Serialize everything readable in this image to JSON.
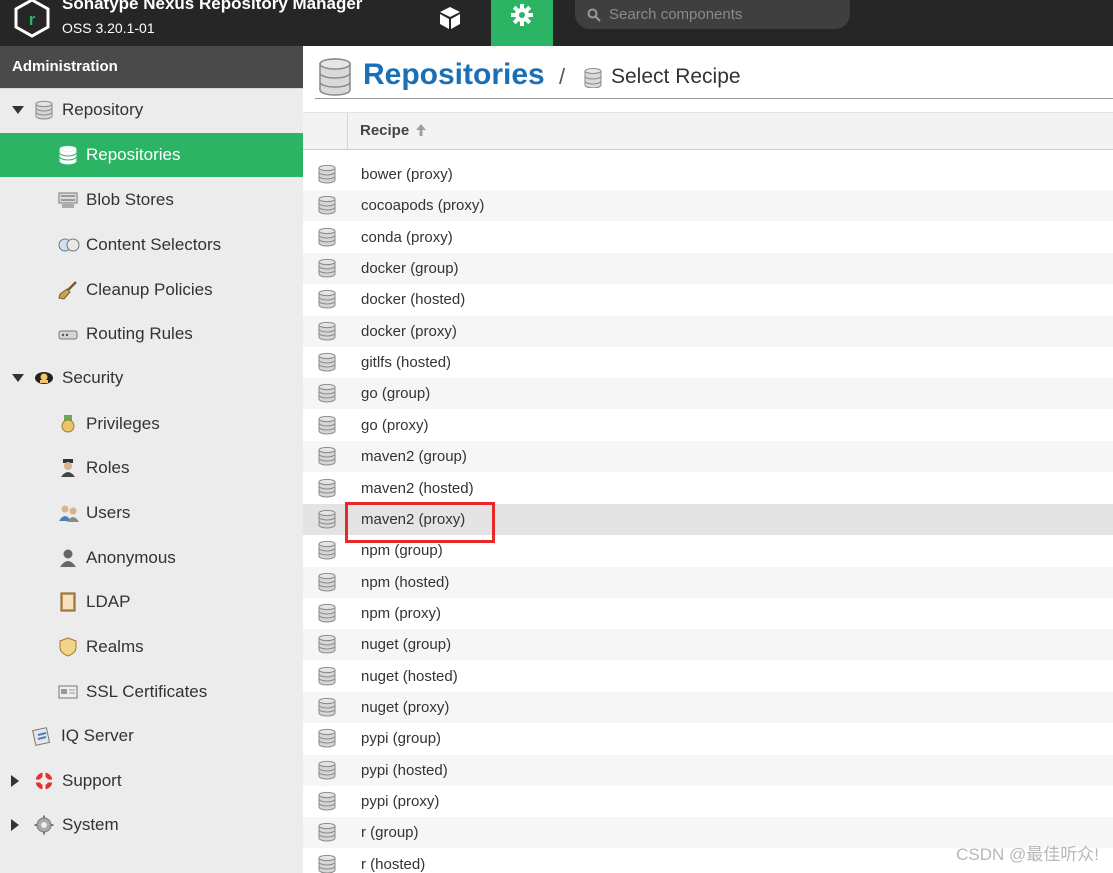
{
  "header": {
    "title": "Sonatype Nexus Repository Manager",
    "version": "OSS 3.20.1-01",
    "search_placeholder": "Search components",
    "icons": [
      "nexus-logo",
      "cube-icon",
      "gear-icon",
      "search-icon"
    ]
  },
  "sidebar": {
    "header": "Administration",
    "items": [
      {
        "label": "Repository",
        "icon": "database-icon",
        "level": 0,
        "toggle": "expanded"
      },
      {
        "label": "Repositories",
        "icon": "database-icon",
        "level": 1,
        "active": true
      },
      {
        "label": "Blob Stores",
        "icon": "server-icon",
        "level": 1
      },
      {
        "label": "Content Selectors",
        "icon": "selector-icon",
        "level": 1
      },
      {
        "label": "Cleanup Policies",
        "icon": "broom-icon",
        "level": 1
      },
      {
        "label": "Routing Rules",
        "icon": "router-icon",
        "level": 1
      },
      {
        "label": "Security",
        "icon": "badge-icon",
        "level": 0,
        "toggle": "expanded"
      },
      {
        "label": "Privileges",
        "icon": "medal-icon",
        "level": 1
      },
      {
        "label": "Roles",
        "icon": "role-icon",
        "level": 1
      },
      {
        "label": "Users",
        "icon": "users-icon",
        "level": 1
      },
      {
        "label": "Anonymous",
        "icon": "anonymous-icon",
        "level": 1
      },
      {
        "label": "LDAP",
        "icon": "book-icon",
        "level": 1
      },
      {
        "label": "Realms",
        "icon": "shield-icon",
        "level": 1
      },
      {
        "label": "SSL Certificates",
        "icon": "certificate-icon",
        "level": 1
      },
      {
        "label": "IQ Server",
        "icon": "iq-icon",
        "level": 0
      },
      {
        "label": "Support",
        "icon": "lifebuoy-icon",
        "level": 0,
        "toggle": "collapsed"
      },
      {
        "label": "System",
        "icon": "cog-icon",
        "level": 0,
        "toggle": "collapsed"
      }
    ]
  },
  "main": {
    "title": "Repositories",
    "breadcrumb_separator": "/",
    "breadcrumb": "Select Recipe",
    "column_header": "Recipe",
    "rows": [
      "bower (proxy)",
      "cocoapods (proxy)",
      "conda (proxy)",
      "docker (group)",
      "docker (hosted)",
      "docker (proxy)",
      "gitlfs (hosted)",
      "go (group)",
      "go (proxy)",
      "maven2 (group)",
      "maven2 (hosted)",
      "maven2 (proxy)",
      "npm (group)",
      "npm (hosted)",
      "npm (proxy)",
      "nuget (group)",
      "nuget (hosted)",
      "nuget (proxy)",
      "pypi (group)",
      "pypi (hosted)",
      "pypi (proxy)",
      "r (group)",
      "r (hosted)"
    ],
    "selected_row": "maven2 (proxy)"
  },
  "watermark": "CSDN @最佳听众!",
  "colors": {
    "topbar": "#262626",
    "accent_green": "#2ab464",
    "title_blue": "#1a6fb5",
    "highlight_red": "#e8282b"
  }
}
